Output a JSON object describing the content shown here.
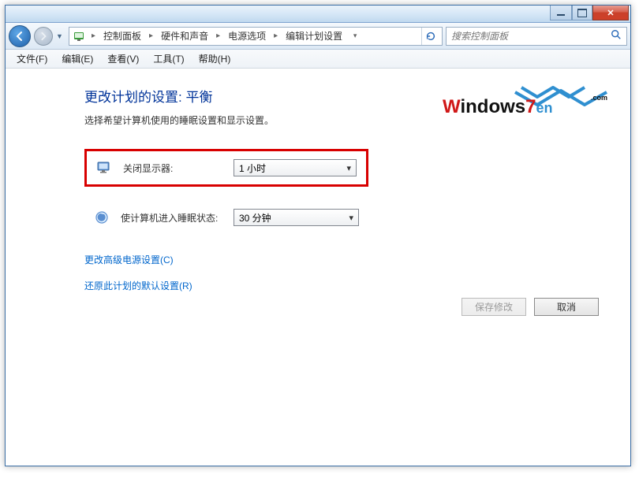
{
  "titlebar": {},
  "breadcrumb": {
    "items": [
      "控制面板",
      "硬件和声音",
      "电源选项",
      "编辑计划设置"
    ]
  },
  "search": {
    "placeholder": "搜索控制面板"
  },
  "menubar": {
    "file": "文件(F)",
    "edit": "编辑(E)",
    "view": "查看(V)",
    "tools": "工具(T)",
    "help": "帮助(H)"
  },
  "page": {
    "title": "更改计划的设置: 平衡",
    "subtitle": "选择希望计算机使用的睡眠设置和显示设置。"
  },
  "settings": {
    "displayOff": {
      "label": "关闭显示器:",
      "value": "1 小时"
    },
    "sleep": {
      "label": "使计算机进入睡眠状态:",
      "value": "30 分钟"
    }
  },
  "links": {
    "advanced": "更改高级电源设置(C)",
    "restore": "还原此计划的默认设置(R)"
  },
  "buttons": {
    "save": "保存修改",
    "cancel": "取消"
  },
  "watermark": {
    "text": "Windows7",
    "suffix": "en",
    "dotcom": ".com"
  }
}
